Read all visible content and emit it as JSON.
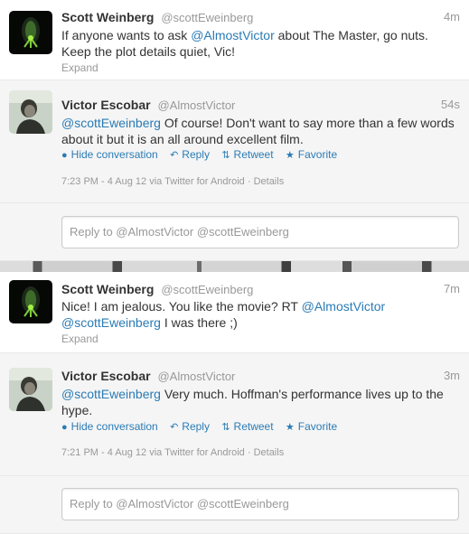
{
  "panel_a": {
    "tweet1": {
      "fullname": "Scott Weinberg",
      "username": "@scottEweinberg",
      "time": "4m",
      "text_pre": "If anyone wants to ask ",
      "mention": "@AlmostVictor",
      "text_post": " about The Master, go nuts. Keep the plot details quiet, Vic!",
      "expand": "Expand"
    },
    "tweet2": {
      "fullname": "Victor Escobar",
      "username": "@AlmostVictor",
      "time": "54s",
      "mention": "@scottEweinberg",
      "text_post": " Of course! Don't want to say more than a few words about it but it is an all around excellent film.",
      "actions": {
        "hide": "Hide conversation",
        "reply": "Reply",
        "retweet": "Retweet",
        "favorite": "Favorite"
      },
      "meta": "7:23 PM - 4 Aug 12 via Twitter for Android · Details"
    },
    "reply_placeholder": "Reply to @AlmostVictor @scottEweinberg"
  },
  "panel_b": {
    "tweet1": {
      "fullname": "Scott Weinberg",
      "username": "@scottEweinberg",
      "time": "7m",
      "text_pre": "Nice! I am jealous. You like the movie? RT ",
      "mention1": "@AlmostVictor",
      "mention2": "@scottEweinberg",
      "text_post": " I was there ;)",
      "expand": "Expand"
    },
    "tweet2": {
      "fullname": "Victor Escobar",
      "username": "@AlmostVictor",
      "time": "3m",
      "mention": "@scottEweinberg",
      "text_post": " Very much. Hoffman's performance lives up to the hype.",
      "actions": {
        "hide": "Hide conversation",
        "reply": "Reply",
        "retweet": "Retweet",
        "favorite": "Favorite"
      },
      "meta": "7:21 PM - 4 Aug 12 via Twitter for Android · Details"
    },
    "reply_placeholder": "Reply to @AlmostVictor @scottEweinberg"
  },
  "icons": {
    "hide": "speech-bubble-icon",
    "reply": "reply-arrow-icon",
    "retweet": "retweet-icon",
    "favorite": "star-icon"
  },
  "colors": {
    "link": "#2a7bb5",
    "muted": "#999999",
    "text": "#333333"
  }
}
